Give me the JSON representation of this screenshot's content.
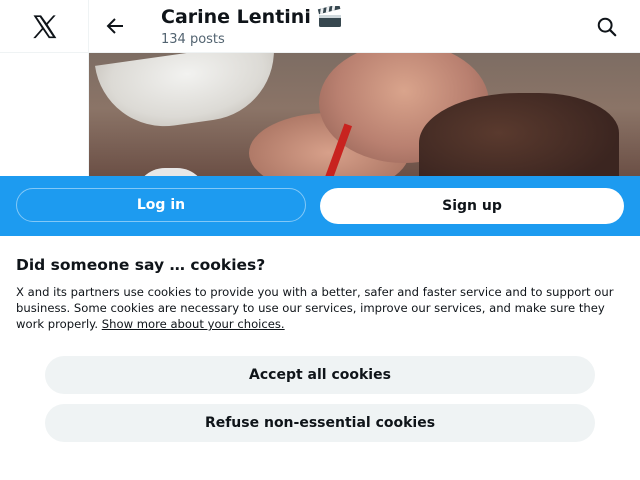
{
  "header": {
    "title": "Carine Lentini",
    "posts_count": "134 posts",
    "title_icon": "clapperboard-emoji",
    "back_icon": "arrow-left-icon",
    "search_icon": "search-icon"
  },
  "sidebar": {
    "logo_icon": "x-logo-icon"
  },
  "login_bar": {
    "login_label": "Log in",
    "signup_label": "Sign up"
  },
  "cookie_banner": {
    "title": "Did someone say … cookies?",
    "body": "X and its partners use cookies to provide you with a better, safer and faster service and to support our business. Some cookies are necessary to use our services, improve our services, and make sure they work properly.",
    "link_label": "Show more about your choices.",
    "accept_label": "Accept all cookies",
    "refuse_label": "Refuse non-essential cookies"
  },
  "colors": {
    "accent": "#1d9bf0",
    "text": "#0f1419",
    "muted": "#536471",
    "button_gray": "#eff3f4"
  }
}
